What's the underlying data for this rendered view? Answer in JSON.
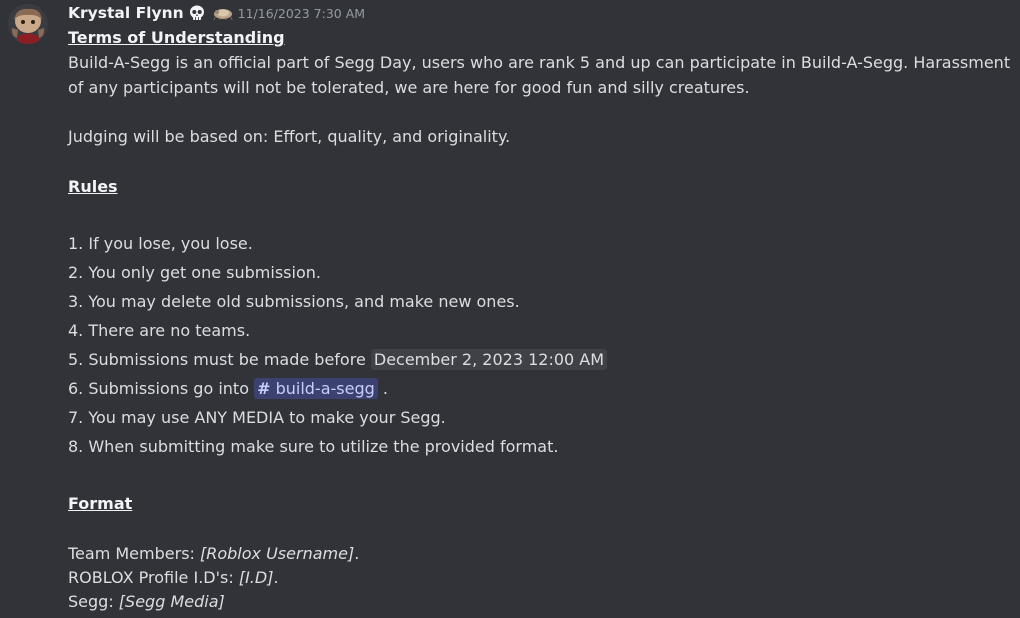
{
  "message": {
    "author": "Krystal Flynn",
    "timestamp": "11/16/2023 7:30 AM",
    "colors": {
      "background": "#313338",
      "mention_bg": "#3c4270",
      "mention_fg": "#c9cdfb",
      "timestamp_chip_bg": "#3f4147"
    },
    "icons": {
      "avatar": "avatar",
      "badge": "skull-icon",
      "role": "role-icon"
    },
    "terms_heading": "Terms of Understanding",
    "intro": "Build-A-Segg is an official part of Segg Day, users who are rank 5 and up can participate in Build-A-Segg. Harassment of any participants will not be tolerated, we are here for good fun and silly creatures.",
    "judging": "Judging will be based on: Effort, quality, and originality.",
    "rules_heading": "Rules",
    "rules": {
      "r1": "1. If you lose, you lose.",
      "r2": "2. You only get one submission.",
      "r3": "3. You may delete old submissions, and make new ones.",
      "r4": "4. There are no teams.",
      "r5_prefix": "5. Submissions must be made before",
      "r5_time": "December 2, 2023 12:00 AM",
      "r6_prefix": "6. Submissions go into",
      "r6_channel_hash": "#",
      "r6_channel": "build-a-segg",
      "r6_suffix": ".",
      "r7": "7. You may use ANY MEDIA to make your Segg.",
      "r8": "8. When submitting make sure to utilize the provided format."
    },
    "format_heading": "Format",
    "format": {
      "team_label": "Team Members: ",
      "team_value": "[Roblox Username]",
      "team_suffix": ".",
      "profile_label": "ROBLOX Profile I.D's: ",
      "profile_value": "[I.D]",
      "profile_suffix": ".",
      "segg_label": "Segg: ",
      "segg_value": "[Segg Media]"
    }
  }
}
